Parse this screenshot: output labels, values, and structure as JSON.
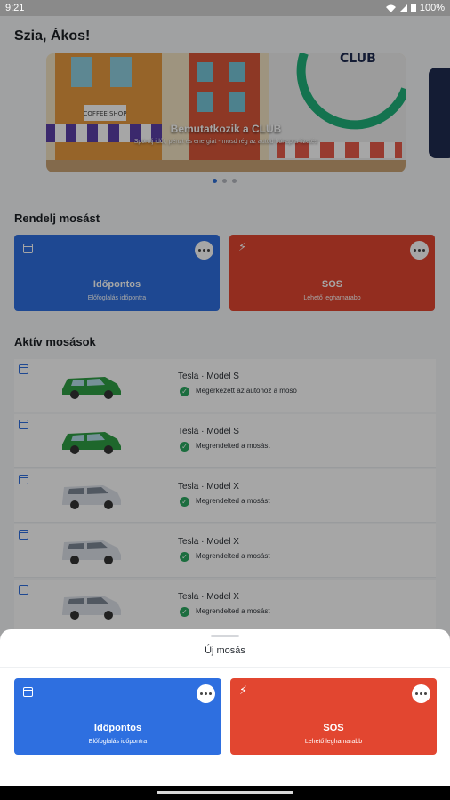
{
  "status_bar": {
    "time": "9:21",
    "battery": "100%"
  },
  "greeting": "Szia, Ákos!",
  "banner": {
    "title": "Bemutatkozik a CLUB",
    "subtitle": "Spórolj időt, pénzt és energiát - mosd rég az autód hónapra fizetés"
  },
  "order_section": {
    "title": "Rendelj mosást",
    "cards": [
      {
        "title": "Időpontos",
        "subtitle": "Előfoglalás időpontra"
      },
      {
        "title": "SOS",
        "subtitle": "Lehető leghamarabb"
      }
    ]
  },
  "active_section": {
    "title": "Aktív mosások",
    "items": [
      {
        "model": "Tesla · Model S",
        "status": "Megérkezett az autóhoz a mosó",
        "car_color": "#2f9e44"
      },
      {
        "model": "Tesla · Model S",
        "status": "Megrendelted a mosást",
        "car_color": "#2f9e44"
      },
      {
        "model": "Tesla · Model X",
        "status": "Megrendelted a mosást",
        "car_color": "#dde2ea"
      },
      {
        "model": "Tesla · Model X",
        "status": "Megrendelted a mosást",
        "car_color": "#dde2ea"
      },
      {
        "model": "Tesla · Model X",
        "status": "Megrendelted a mosást",
        "car_color": "#dde2ea"
      }
    ]
  },
  "sheet": {
    "title": "Új mosás",
    "cards": [
      {
        "title": "Időpontos",
        "subtitle": "Előfoglalás időpontra"
      },
      {
        "title": "SOS",
        "subtitle": "Lehető leghamarabb"
      }
    ]
  },
  "colors": {
    "accent_blue": "#2e6fe0",
    "accent_red": "#e24630",
    "success": "#2aa860"
  }
}
